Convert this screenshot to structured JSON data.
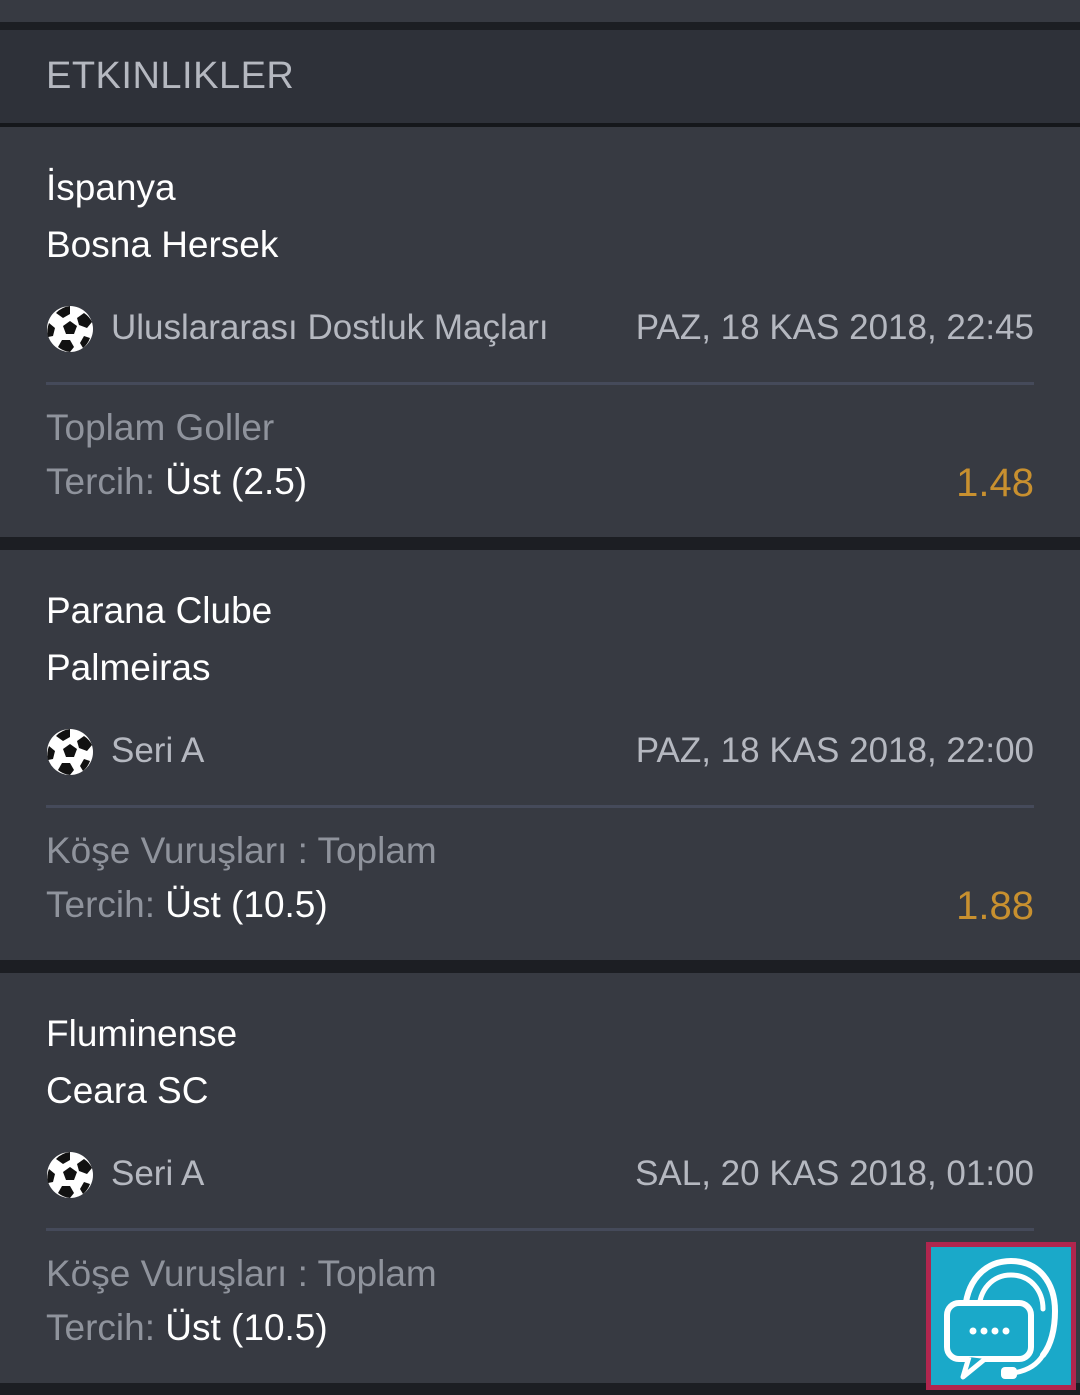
{
  "section": {
    "title": "ETKINLIKLER"
  },
  "events": [
    {
      "team1": "İspanya",
      "team2": "Bosna Hersek",
      "league": "Uluslararası Dostluk Maçları",
      "datetime": "PAZ, 18 KAS 2018, 22:45",
      "market": "Toplam Goller",
      "pick_label": "Tercih: ",
      "pick_value": "Üst (2.5)",
      "odds": "1.48",
      "sport_icon": "soccer-ball-icon"
    },
    {
      "team1": "Parana Clube",
      "team2": "Palmeiras",
      "league": "Seri A",
      "datetime": "PAZ, 18 KAS 2018, 22:00",
      "market": "Köşe Vuruşları : Toplam",
      "pick_label": "Tercih: ",
      "pick_value": "Üst (10.5)",
      "odds": "1.88",
      "sport_icon": "soccer-ball-icon"
    },
    {
      "team1": "Fluminense",
      "team2": "Ceara SC",
      "league": "Seri A",
      "datetime": "SAL, 20 KAS 2018, 01:00",
      "market": "Köşe Vuruşları : Toplam",
      "pick_label": "Tercih: ",
      "pick_value": "Üst (10.5)",
      "odds": "",
      "sport_icon": "soccer-ball-icon"
    }
  ],
  "support_button": {
    "icon": "support-chat-headset-icon"
  },
  "colors": {
    "background": "#1f2126",
    "card": "#373a42",
    "header": "#2e3139",
    "odds": "#c8902f",
    "muted_text": "#8f939c",
    "support_bg": "#1aa9c9",
    "support_border": "#b0264e"
  }
}
